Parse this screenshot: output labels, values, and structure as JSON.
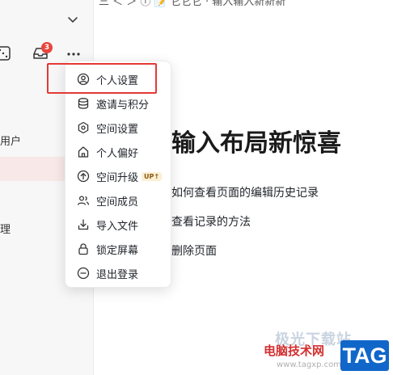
{
  "header": {
    "breadcrumb_fragment": "三 ＜ ＞ ⓘ 📝 它它它 · 输入输入新新新"
  },
  "sidebar": {
    "inbox_badge_count": "3",
    "users_text": "用户",
    "manage_text": "理"
  },
  "document": {
    "title": "输入布局新惊喜",
    "lines": [
      "如何查看页面的编辑历史记录",
      "查看记录的方法",
      "删除页面"
    ]
  },
  "menu": {
    "items": [
      {
        "label": "个人设置",
        "icon": "user-circle-icon"
      },
      {
        "label": "邀请与积分",
        "icon": "coins-icon"
      },
      {
        "label": "空间设置",
        "icon": "hexagon-settings-icon"
      },
      {
        "label": "个人偏好",
        "icon": "home-icon"
      },
      {
        "label": "空间升级",
        "icon": "arrow-up-circle-icon",
        "badge": "UP↑"
      },
      {
        "label": "空间成员",
        "icon": "members-icon"
      },
      {
        "label": "导入文件",
        "icon": "import-icon"
      },
      {
        "label": "锁定屏幕",
        "icon": "lock-icon"
      },
      {
        "label": "退出登录",
        "icon": "minus-circle-icon"
      }
    ]
  },
  "watermark": {
    "faint_text": "极光下载站",
    "site_name": "电脑技术网",
    "url": "www.tagxp.com",
    "tag": "TAG"
  },
  "colors": {
    "highlight_border": "#e53935",
    "badge": "#e8453c",
    "sidebar_bg": "#f7f7f8",
    "active_row": "#f8e8e8",
    "tag_bg": "#1167c9"
  }
}
